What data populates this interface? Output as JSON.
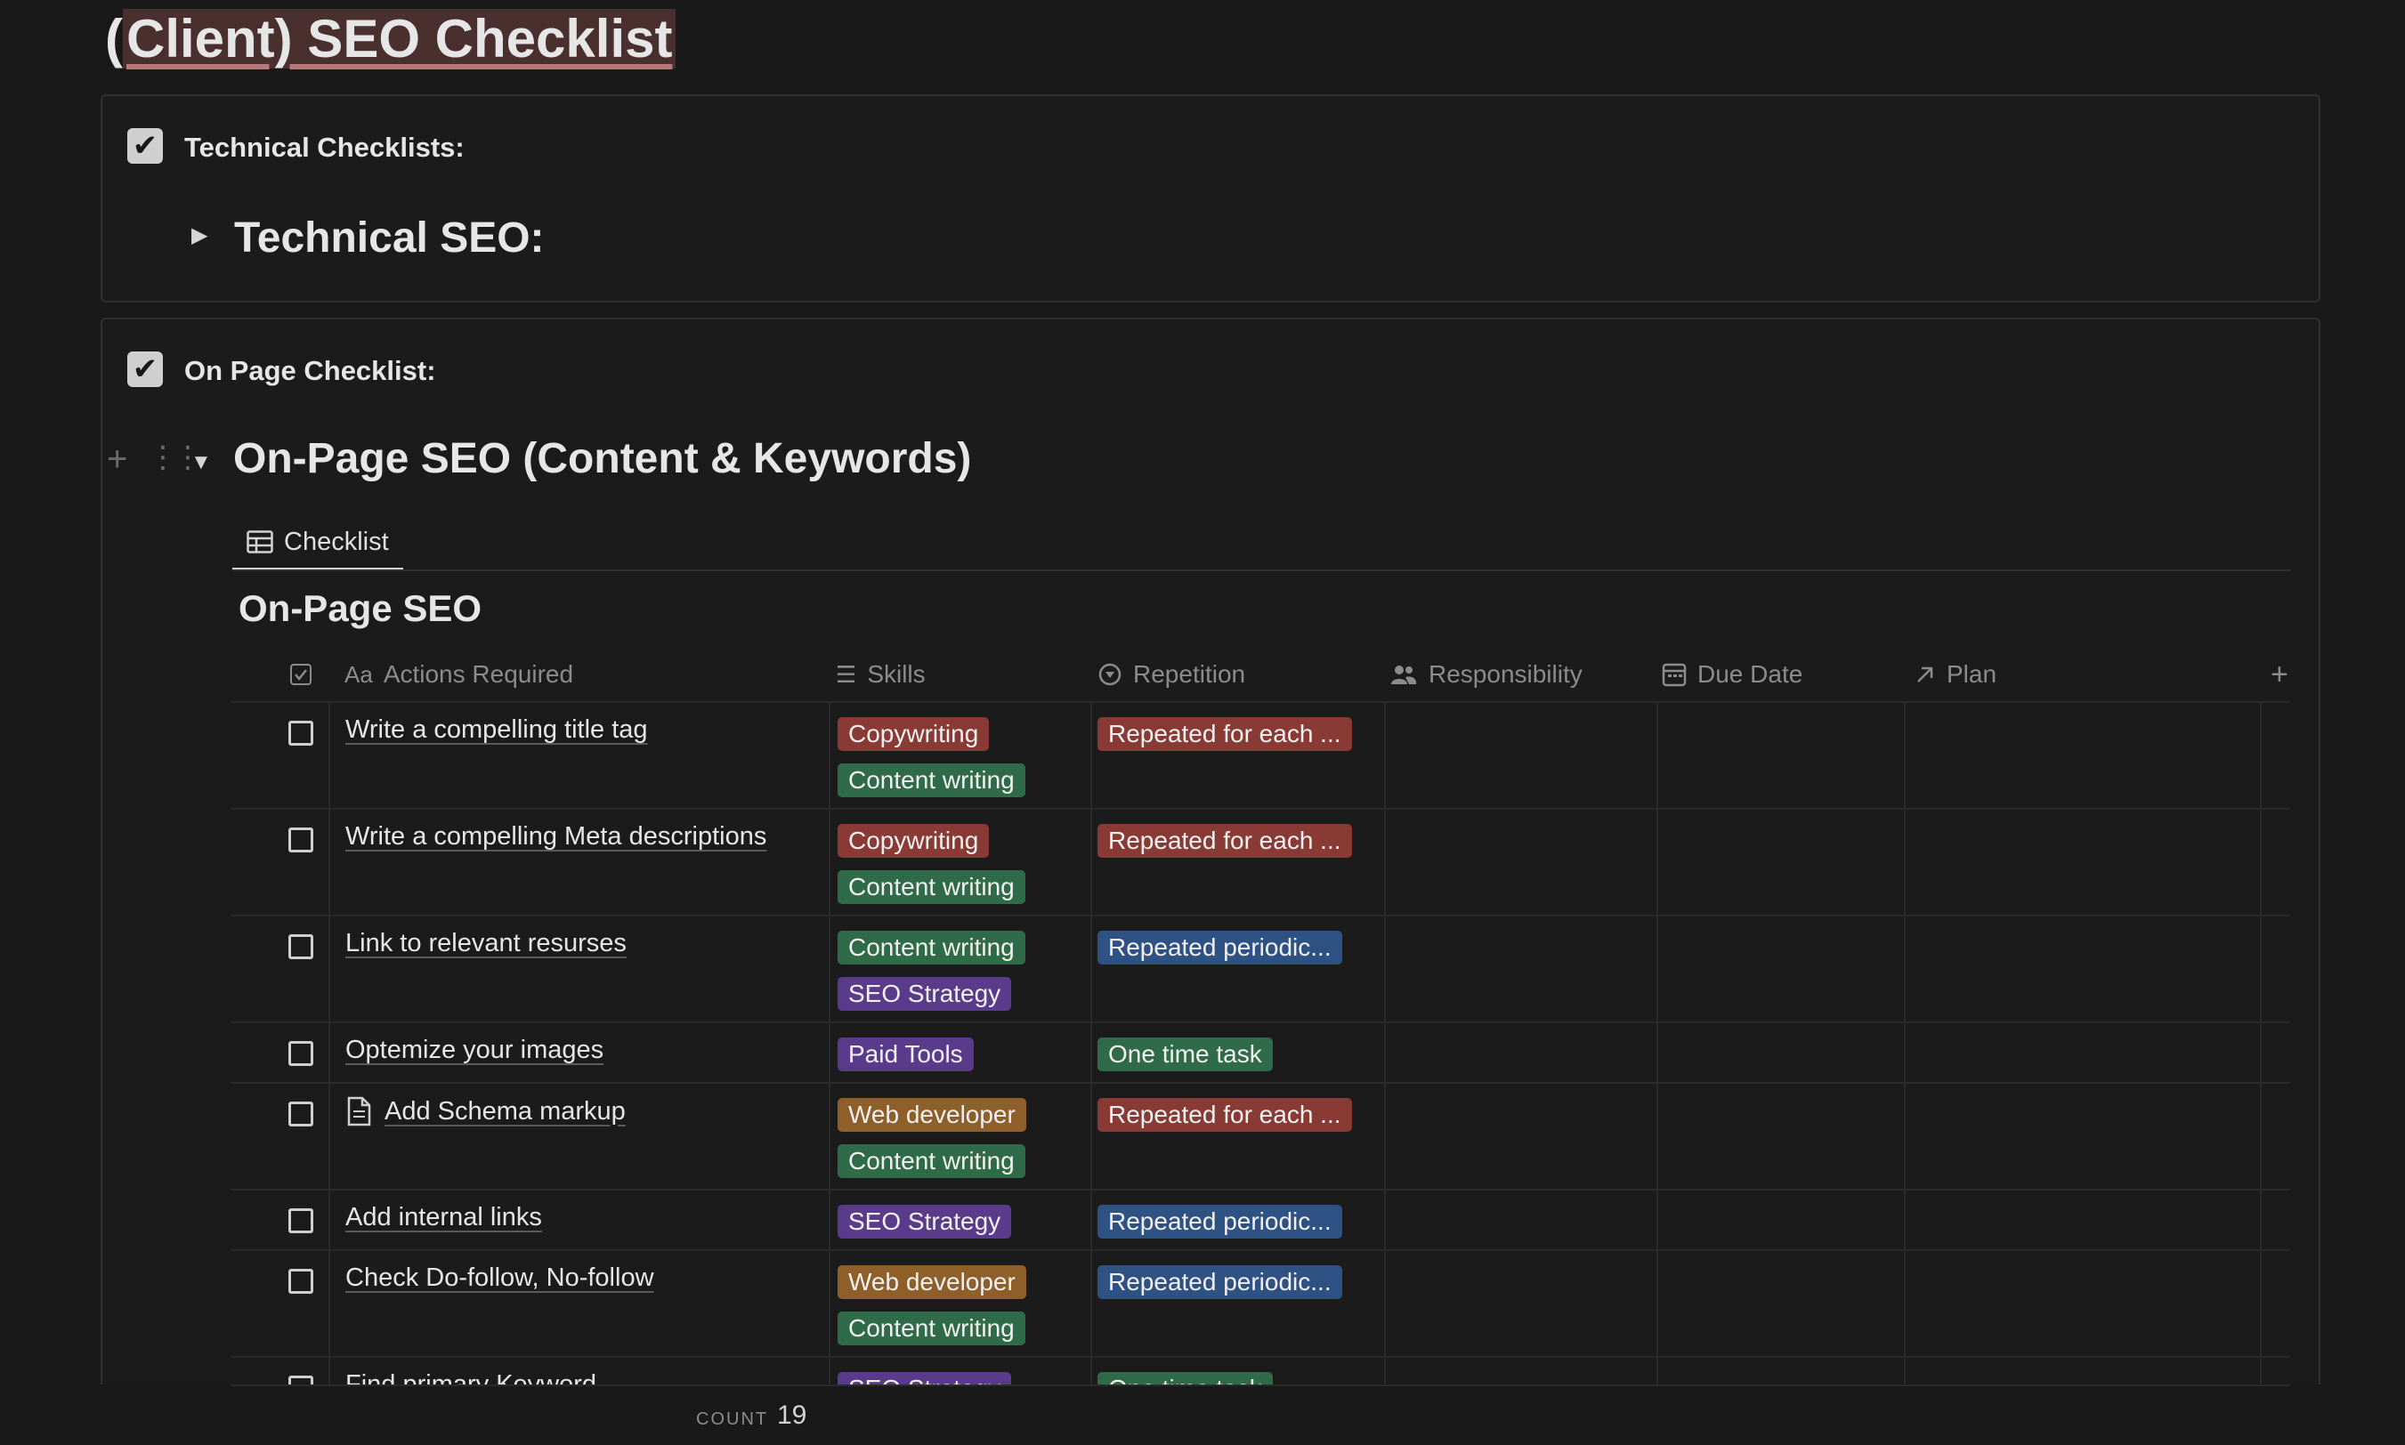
{
  "page": {
    "title_prefix": "(",
    "title_main": "Client) SEO Checklist"
  },
  "callout1": {
    "label": "Technical Checklists:",
    "toggle_heading": "Technical SEO:"
  },
  "callout2": {
    "label": "On Page Checklist:",
    "toggle_heading": "On-Page SEO (Content & Keywords)"
  },
  "database": {
    "tab_label": "Checklist",
    "title": "On-Page SEO",
    "columns": {
      "actions": "Actions Required",
      "skills": "Skills",
      "repetition": "Repetition",
      "responsibility": "Responsibility",
      "due_date": "Due Date",
      "plan": "Plan"
    },
    "header_prefix": "Aa",
    "rows": [
      {
        "action": "Write a compelling title tag",
        "skills": [
          "Copywriting",
          "Content writing"
        ],
        "repetition": "Repeated for each ..."
      },
      {
        "action": "Write a compelling Meta descriptions",
        "skills": [
          "Copywriting",
          "Content writing"
        ],
        "repetition": "Repeated for each ..."
      },
      {
        "action": "Link to relevant resurses",
        "skills": [
          "Content writing",
          "SEO Strategy"
        ],
        "repetition": "Repeated periodic..."
      },
      {
        "action": "Optemize your images",
        "skills": [
          "Paid Tools"
        ],
        "repetition": "One time task"
      },
      {
        "action": "Add Schema markup",
        "skills": [
          "Web developer",
          "Content writing"
        ],
        "repetition": "Repeated for each ..."
      },
      {
        "action": "Add internal links",
        "skills": [
          "SEO Strategy"
        ],
        "repetition": "Repeated periodic..."
      },
      {
        "action": "Check Do-follow, No-follow",
        "skills": [
          "Web developer",
          "Content writing"
        ],
        "repetition": "Repeated periodic..."
      },
      {
        "action": "Find primary Keyword",
        "skills": [
          "SEO Strategy"
        ],
        "repetition": "One time task"
      }
    ],
    "footer": {
      "count_label": "COUNT",
      "count_value": "19"
    }
  },
  "colors": {
    "background": "#191919",
    "tag_red": "#8a3a35",
    "tag_green": "#2f6b48",
    "tag_purple": "#5a3a8a",
    "tag_brown": "#8f5f2a",
    "tag_blue": "#2e5284"
  },
  "icons": {
    "callout": "checkbox-checked-icon",
    "toggle_collapsed": "triangle-right-icon",
    "toggle_expanded": "triangle-down-icon",
    "tab": "table-icon",
    "checkbox_column": "checkbox-property-icon",
    "skills": "multi-select-icon",
    "repetition": "status-icon",
    "responsibility": "people-icon",
    "due_date": "calendar-icon",
    "plan": "relation-arrow-icon",
    "add_column": "plus-icon",
    "schema_page": "page-icon"
  }
}
